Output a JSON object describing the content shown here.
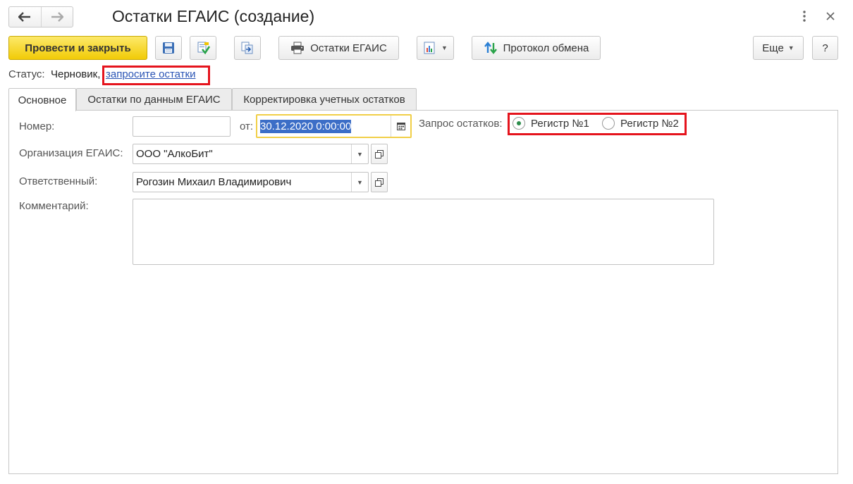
{
  "window": {
    "title": "Остатки ЕГАИС (создание)",
    "more_icon": "vertical-dots-icon",
    "close_icon": "close-icon",
    "back_icon": "arrow-left-icon",
    "forward_icon": "arrow-right-icon"
  },
  "toolbar": {
    "post_close_label": "Провести и закрыть",
    "save_icon": "floppy-disk-icon",
    "post_icon": "post-document-icon",
    "basis_icon": "create-based-on-icon",
    "print_label": "Остатки ЕГАИС",
    "print_icon": "printer-icon",
    "reports_icon": "report-icon",
    "exchange_log_label": "Протокол обмена",
    "exchange_icon": "exchange-arrows-icon",
    "more_label": "Еще",
    "help_label": "?"
  },
  "status": {
    "label": "Статус:",
    "value": "Черновик,",
    "link": "запросите остатки"
  },
  "tabs": [
    {
      "label": "Основное",
      "active": true
    },
    {
      "label": "Остатки по данным ЕГАИС",
      "active": false
    },
    {
      "label": "Корректировка учетных остатков",
      "active": false
    }
  ],
  "form": {
    "number_label": "Номер:",
    "number_value": "",
    "date_label": "от:",
    "date_value": "30.12.2020  0:00:00",
    "request_label": "Запрос остатков:",
    "register1_label": "Регистр №1",
    "register2_label": "Регистр №2",
    "register_selected": 1,
    "org_label": "Организация ЕГАИС:",
    "org_value": "ООО \"АлкоБит\"",
    "resp_label": "Ответственный:",
    "resp_value": "Рогозин Михаил Владимирович",
    "comment_label": "Комментарий:",
    "comment_value": ""
  },
  "colors": {
    "primary_button": "#f1cb07",
    "highlight_box": "#e5141d",
    "link": "#2b55b5",
    "date_focus": "#f1cf47",
    "selection": "#3c6ec7"
  }
}
